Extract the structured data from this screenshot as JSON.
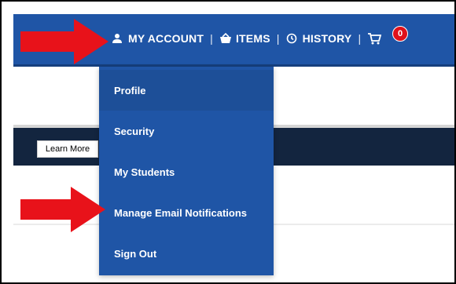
{
  "nav": {
    "my_account": "MY ACCOUNT",
    "items": "ITEMS",
    "history": "HISTORY",
    "separator": "|",
    "cart_count": "0",
    "icons": {
      "account": "user-icon",
      "items": "basket-icon",
      "history": "history-clock-icon",
      "cart": "cart-icon"
    }
  },
  "banner": {
    "learn_more": "Learn More"
  },
  "dropdown": {
    "items": [
      {
        "label": "Profile"
      },
      {
        "label": "Security"
      },
      {
        "label": "My Students"
      },
      {
        "label": "Manage Email Notifications"
      },
      {
        "label": "Sign Out"
      }
    ]
  },
  "annotations": {
    "arrow_color": "#e8121a"
  },
  "colors": {
    "nav_blue": "#1f55a6",
    "banner_navy": "#13253f",
    "badge_red": "#e0111a"
  }
}
